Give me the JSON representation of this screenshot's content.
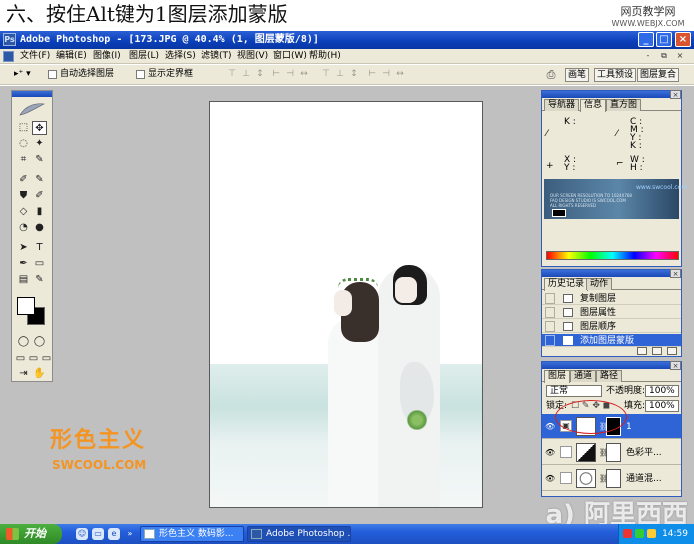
{
  "tutorial": {
    "step_title": "六、按住Alt键为1图层添加蒙版",
    "site_line1": "网页教学网",
    "site_line2": "WWW.WEBJX.COM"
  },
  "window": {
    "title": "Adobe Photoshop - [173.JPG @ 40.4% (1, 图层蒙版/8)]",
    "min": "_",
    "max": "□",
    "close": "×",
    "inner_min": "-",
    "inner_max": "⧉",
    "inner_close": "×"
  },
  "menu": [
    "文件(F)",
    "编辑(E)",
    "图像(I)",
    "图层(L)",
    "选择(S)",
    "滤镜(T)",
    "视图(V)",
    "窗口(W)",
    "帮助(H)"
  ],
  "options": {
    "tool_preset": "▸⁺ ▾",
    "auto_select": "自动选择图层",
    "show_bounds": "显示定界框",
    "align_icons": [
      "⊤",
      "⊥",
      "↕",
      "⊢",
      "⊣",
      "↔",
      "⊤",
      "⊥",
      "↕",
      "⊢",
      "⊣",
      "↔"
    ],
    "tab_brushes": "画笔",
    "tab_presets": "工具预设",
    "tab_comps": "图层复合"
  },
  "toolbox": {
    "tools": [
      "⬚",
      "✥",
      "◌",
      "✦",
      "⌗",
      "✎",
      "✐",
      "✎",
      "⛊",
      "✐",
      "◇",
      "▮",
      "◔",
      "●",
      "➤",
      "T",
      "✒",
      "▭",
      "▤",
      "✎",
      "✋",
      "⚲",
      "◯",
      "◯",
      "▭",
      "▭",
      "▭",
      "▭",
      "⇥",
      "⇥"
    ]
  },
  "navigator": {
    "tabs": [
      "导航器",
      "信息",
      "直方图"
    ],
    "k_label": "K :",
    "cmyk_labels": [
      "C :",
      "M :",
      "Y :",
      "K :"
    ],
    "xy_labels": [
      "X :",
      "Y :"
    ],
    "wh_labels": [
      "W :",
      "H :"
    ],
    "thumb_text": [
      "OUR SCREEN RESOLUTION TO 1024X768",
      "FAQ DESIGN STUDIO IS SWCOOL.COM",
      "ALL RIGHTS RESERVED"
    ],
    "thumb_brand": "www.swcool.com"
  },
  "history": {
    "tabs": [
      "历史记录",
      "动作"
    ],
    "items": [
      "复制图层",
      "图层属性",
      "图层顺序",
      "添加图层蒙版"
    ],
    "selected_index": 3
  },
  "layers": {
    "tabs": [
      "图层",
      "通道",
      "路径"
    ],
    "blend_mode": "正常",
    "opacity_label": "不透明度:",
    "opacity_value": "100%",
    "lock_label": "锁定:",
    "fill_label": "填充:",
    "fill_value": "100%",
    "rows": [
      {
        "name": "1",
        "selected": true
      },
      {
        "name": "色彩平...",
        "selected": false
      },
      {
        "name": "通道混...",
        "selected": false
      }
    ]
  },
  "canvas_watermark": {
    "cn": "形色主义",
    "url": "SWCOOL.COM"
  },
  "taskbar": {
    "start": "开始",
    "tasks": [
      "形色主义 数码影...",
      "Adobe Photoshop ..."
    ],
    "clock": "14:59"
  },
  "corner_watermark": "a) 阿里西西"
}
